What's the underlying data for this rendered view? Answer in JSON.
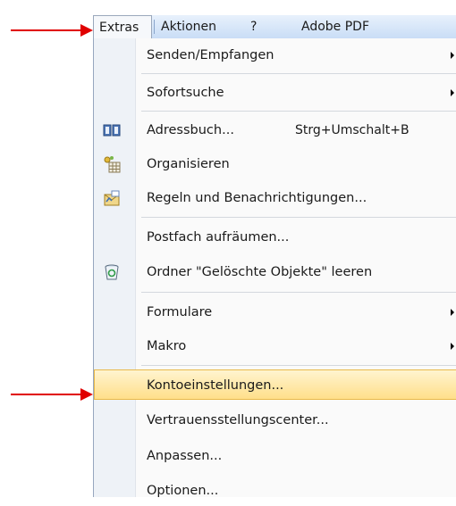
{
  "menubar": {
    "extras": "Extras",
    "aktionen": "Aktionen",
    "help": "?",
    "adobe_pdf": "Adobe PDF"
  },
  "menu": {
    "senden": "Senden/Empfangen",
    "sofortsuche": "Sofortsuche",
    "adressbuch": "Adressbuch...",
    "adressbuch_shortcut": "Strg+Umschalt+B",
    "organisieren": "Organisieren",
    "regeln": "Regeln und Benachrichtigungen...",
    "postfach": "Postfach aufräumen...",
    "ordner_leeren": "Ordner \"Gelöschte Objekte\" leeren",
    "formulare": "Formulare",
    "makro": "Makro",
    "kontoeinstellungen": "Kontoeinstellungen...",
    "vertrauensstellung": "Vertrauensstellungscenter...",
    "anpassen": "Anpassen...",
    "optionen": "Optionen..."
  },
  "colors": {
    "arrow": "#e00000",
    "highlight": "#ffdf8a",
    "menubar": "#c9ddf6"
  },
  "icons": {
    "adressbuch": "book-icon",
    "organisieren": "organize-icon",
    "regeln": "rules-icon",
    "ordner_leeren": "recycle-bin-icon"
  }
}
